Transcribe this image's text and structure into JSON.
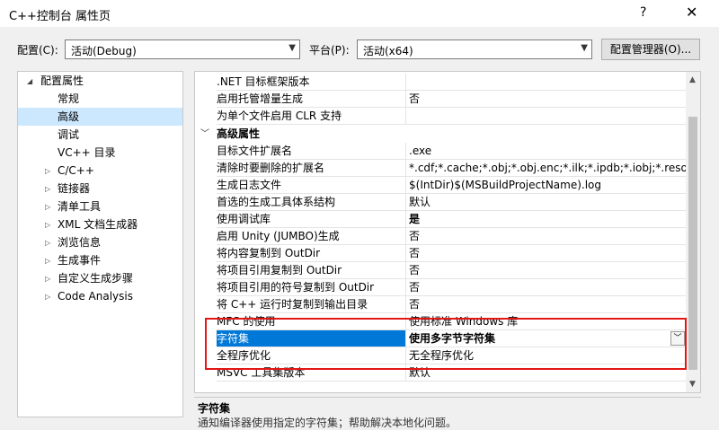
{
  "window": {
    "title": "C++控制台 属性页",
    "help": "?",
    "close": "✕"
  },
  "config": {
    "config_label": "配置(C):",
    "config_value": "活动(Debug)",
    "platform_label": "平台(P):",
    "platform_value": "活动(x64)",
    "manager_button": "配置管理器(O)..."
  },
  "tree": {
    "root": "配置属性",
    "items": [
      "常规",
      "高级",
      "调试",
      "VC++ 目录",
      "C/C++",
      "链接器",
      "清单工具",
      "XML 文档生成器",
      "浏览信息",
      "生成事件",
      "自定义生成步骤",
      "Code Analysis"
    ]
  },
  "grid": {
    "top_rows": [
      {
        "name": ".NET 目标框架版本",
        "value": ""
      },
      {
        "name": "启用托管增量生成",
        "value": "否"
      },
      {
        "name": "为单个文件启用 CLR 支持",
        "value": ""
      }
    ],
    "category": "高级属性",
    "rows": [
      {
        "name": "目标文件扩展名",
        "value": ".exe"
      },
      {
        "name": "清除时要删除的扩展名",
        "value": "*.cdf;*.cache;*.obj;*.obj.enc;*.ilk;*.ipdb;*.iobj;*.resource"
      },
      {
        "name": "生成日志文件",
        "value": "$(IntDir)$(MSBuildProjectName).log"
      },
      {
        "name": "首选的生成工具体系结构",
        "value": "默认"
      },
      {
        "name": "使用调试库",
        "value": "是"
      },
      {
        "name": "启用 Unity (JUMBO)生成",
        "value": "否"
      },
      {
        "name": "将内容复制到 OutDir",
        "value": "否"
      },
      {
        "name": "将项目引用复制到 OutDir",
        "value": "否"
      },
      {
        "name": "将项目引用的符号复制到 OutDir",
        "value": "否"
      },
      {
        "name": "将 C++ 运行时复制到输出目录",
        "value": "否"
      },
      {
        "name": "MFC 的使用",
        "value": "使用标准 Windows 库"
      },
      {
        "name": "字符集",
        "value": "使用多字节字符集"
      },
      {
        "name": "全程序优化",
        "value": "无全程序优化"
      },
      {
        "name": "MSVC 工具集版本",
        "value": "默认"
      }
    ]
  },
  "description": {
    "title": "字符集",
    "text": "通知编译器使用指定的字符集；帮助解决本地化问题。"
  }
}
